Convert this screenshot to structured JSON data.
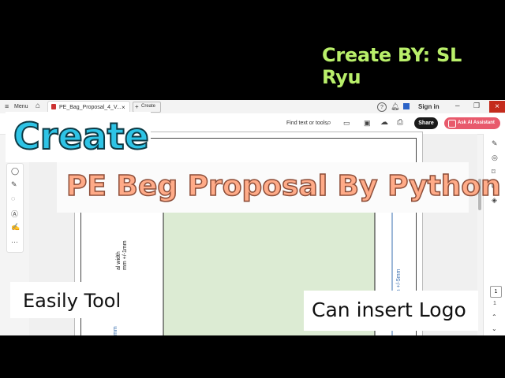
{
  "credit": "Create BY: SL Ryu",
  "browser": {
    "menu_label": "Menu",
    "tab_title": "PE_Bag_Proposal_4_V...",
    "new_tab_label": "Create",
    "sign_in": "Sign in"
  },
  "toolbar": {
    "find_label": "Find text or tools",
    "share_label": "Share",
    "ai_label": "Ask AI Assistant"
  },
  "overlays": {
    "create": "Create",
    "headline": "PE Beg Proposal By Python",
    "easily": "Easily Tool",
    "logo": "Can insert Logo"
  },
  "drawing": {
    "width_note": "al width\nmm +/-1mm",
    "height_note": "0mm +/-5mm",
    "bottom_note": "mm"
  },
  "pager": {
    "current_page": "1",
    "total_pages": "1"
  },
  "colors": {
    "credit": "#b9ef6a",
    "create_fill": "#2ec4e6",
    "headline_fill": "#ffab88",
    "bag_fill": "#dcebd3",
    "dimension_line": "#3a6fb0",
    "share_bg": "#1a1a1a",
    "ai_bg": "#e85a6c"
  }
}
